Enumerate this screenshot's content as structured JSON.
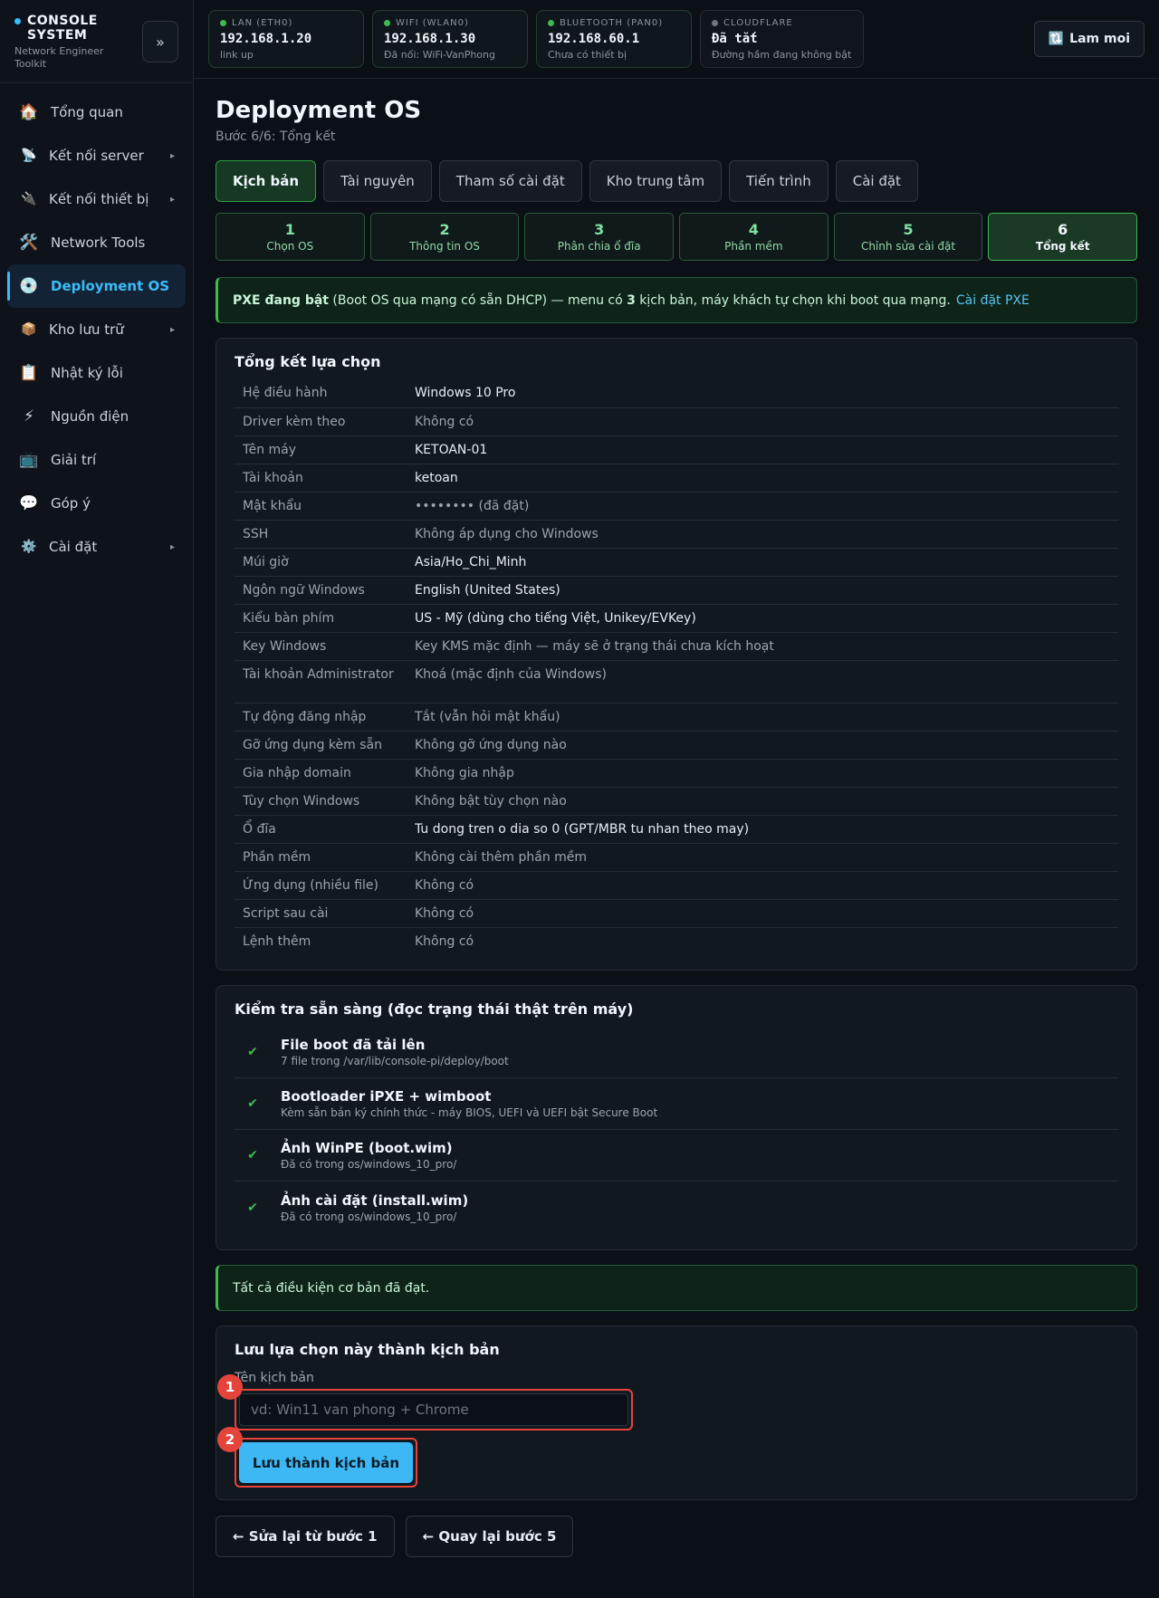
{
  "brand": {
    "title": "CONSOLE SYSTEM",
    "subtitle": "Network Engineer Toolkit",
    "collapse": "»"
  },
  "sidebar": {
    "items": [
      {
        "icon": "🏠",
        "label": "Tổng quan"
      },
      {
        "icon": "📡",
        "label": "Kết nối server",
        "chevron": "▸"
      },
      {
        "icon": "🔌",
        "label": "Kết nối thiết bị",
        "chevron": "▸"
      },
      {
        "icon": "🛠️",
        "label": "Network Tools"
      },
      {
        "icon": "💿",
        "label": "Deployment OS"
      },
      {
        "icon": "📦",
        "label": "Kho lưu trữ",
        "chevron": "▸"
      },
      {
        "icon": "📋",
        "label": "Nhật ký lỗi"
      },
      {
        "icon": "⚡",
        "label": "Nguồn điện"
      },
      {
        "icon": "📺",
        "label": "Giải trí"
      },
      {
        "icon": "💬",
        "label": "Góp ý"
      },
      {
        "icon": "⚙️",
        "label": "Cài đặt",
        "chevron": "▸"
      }
    ]
  },
  "network": [
    {
      "label": "LAN (ETH0)",
      "value": "192.168.1.20",
      "sub": "link up",
      "status_color": "#3fb950"
    },
    {
      "label": "WIFI (WLAN0)",
      "value": "192.168.1.30",
      "sub": "Đã nối: WiFi-VanPhong",
      "status_color": "#3fb950"
    },
    {
      "label": "BLUETOOTH (PAN0)",
      "value": "192.168.60.1",
      "sub": "Chưa có thiết bị",
      "status_color": "#3fb950"
    },
    {
      "label": "CLOUDFLARE",
      "value": "Đã tắt",
      "sub": "Đường hầm đang không bật",
      "status_color": "#6e7681"
    }
  ],
  "topbar": {
    "refresh_icon": "🔃",
    "refresh_label": "Lam moi"
  },
  "page": {
    "title": "Deployment OS",
    "subtitle": "Bước 6/6: Tổng kết"
  },
  "tabs": [
    "Kịch bản",
    "Tài nguyên",
    "Tham số cài đặt",
    "Kho trung tâm",
    "Tiến trình",
    "Cài đặt"
  ],
  "steps": [
    {
      "num": "1",
      "label": "Chọn OS"
    },
    {
      "num": "2",
      "label": "Thông tin OS"
    },
    {
      "num": "3",
      "label": "Phân chia ổ đĩa"
    },
    {
      "num": "4",
      "label": "Phần mềm"
    },
    {
      "num": "5",
      "label": "Chỉnh sửa cài đặt"
    },
    {
      "num": "6",
      "label": "Tổng kết"
    }
  ],
  "pxe_alert": {
    "strong": "PXE đang bật",
    "text1": " (Boot OS qua mạng có sẵn DHCP) — menu có ",
    "count": "3",
    "text2": " kịch bản, máy khách tự chọn khi boot qua mạng.",
    "link": "Cài đặt PXE"
  },
  "summary": {
    "title": "Tổng kết lựa chọn",
    "rows": [
      {
        "k": "Hệ điều hành",
        "v": "Windows 10 Pro",
        "muted": false
      },
      {
        "k": "Driver kèm theo",
        "v": "Không có",
        "muted": true
      },
      {
        "k": "Tên máy",
        "v": "KETOAN-01",
        "muted": false
      },
      {
        "k": "Tài khoản",
        "v": "ketoan",
        "muted": false
      },
      {
        "k": "Mật khẩu",
        "v": "•••••••• (đã đặt)",
        "muted": true
      },
      {
        "k": "SSH",
        "v": "Không áp dụng cho Windows",
        "muted": true
      },
      {
        "k": "Múi giờ",
        "v": "Asia/Ho_Chi_Minh",
        "muted": false
      },
      {
        "k": "Ngôn ngữ Windows",
        "v": "English (United States)",
        "muted": false
      },
      {
        "k": "Kiểu bàn phím",
        "v": "US - Mỹ (dùng cho tiếng Việt, Unikey/EVKey)",
        "muted": false
      },
      {
        "k": "Key Windows",
        "v": "Key KMS mặc định — máy sẽ ở trạng thái chưa kích hoạt",
        "muted": true
      },
      {
        "k": "Tài khoản Administrator",
        "v": "Khoá (mặc định của Windows)",
        "muted": true,
        "tall": true
      },
      {
        "k": "Tự động đăng nhập",
        "v": "Tắt (vẫn hỏi mật khẩu)",
        "muted": true
      },
      {
        "k": "Gỡ ứng dụng kèm sẵn",
        "v": "Không gỡ ứng dụng nào",
        "muted": true
      },
      {
        "k": "Gia nhập domain",
        "v": "Không gia nhập",
        "muted": true
      },
      {
        "k": "Tùy chọn Windows",
        "v": "Không bật tùy chọn nào",
        "muted": true
      },
      {
        "k": "Ổ đĩa",
        "v": "Tu dong tren o dia so 0 (GPT/MBR tu nhan theo may)",
        "muted": false
      },
      {
        "k": "Phần mềm",
        "v": "Không cài thêm phần mềm",
        "muted": true
      },
      {
        "k": "Ứng dụng (nhiều file)",
        "v": "Không có",
        "muted": true
      },
      {
        "k": "Script sau cài",
        "v": "Không có",
        "muted": true
      },
      {
        "k": "Lệnh thêm",
        "v": "Không có",
        "muted": true
      }
    ]
  },
  "readiness": {
    "title": "Kiểm tra sẵn sàng (đọc trạng thái thật trên máy)",
    "icon": "✔",
    "items": [
      {
        "title": "File boot đã tải lên",
        "sub": "7 file trong /var/lib/console-pi/deploy/boot"
      },
      {
        "title": "Bootloader iPXE + wimboot",
        "sub": "Kèm sẵn bản ký chính thức - máy BIOS, UEFI và UEFI bật Secure Boot"
      },
      {
        "title": "Ảnh WinPE (boot.wim)",
        "sub": "Đã có trong os/windows_10_pro/"
      },
      {
        "title": "Ảnh cài đặt (install.wim)",
        "sub": "Đã có trong os/windows_10_pro/"
      }
    ]
  },
  "ready_alert": "Tất cả điều kiện cơ bản đã đạt.",
  "save": {
    "title": "Lưu lựa chọn này thành kịch bản",
    "field_label": "Tên kịch bản",
    "placeholder": "vd: Win11 van phong + Chrome",
    "button": "Lưu thành kịch bản",
    "badge1": "1",
    "badge2": "2"
  },
  "bottom": {
    "back_step1": "← Sửa lại từ bước 1",
    "back_step5": "← Quay lại bước 5"
  },
  "colors": {
    "accent": "#38bdf8",
    "success": "#3fb950",
    "highlight": "#e5443b"
  }
}
